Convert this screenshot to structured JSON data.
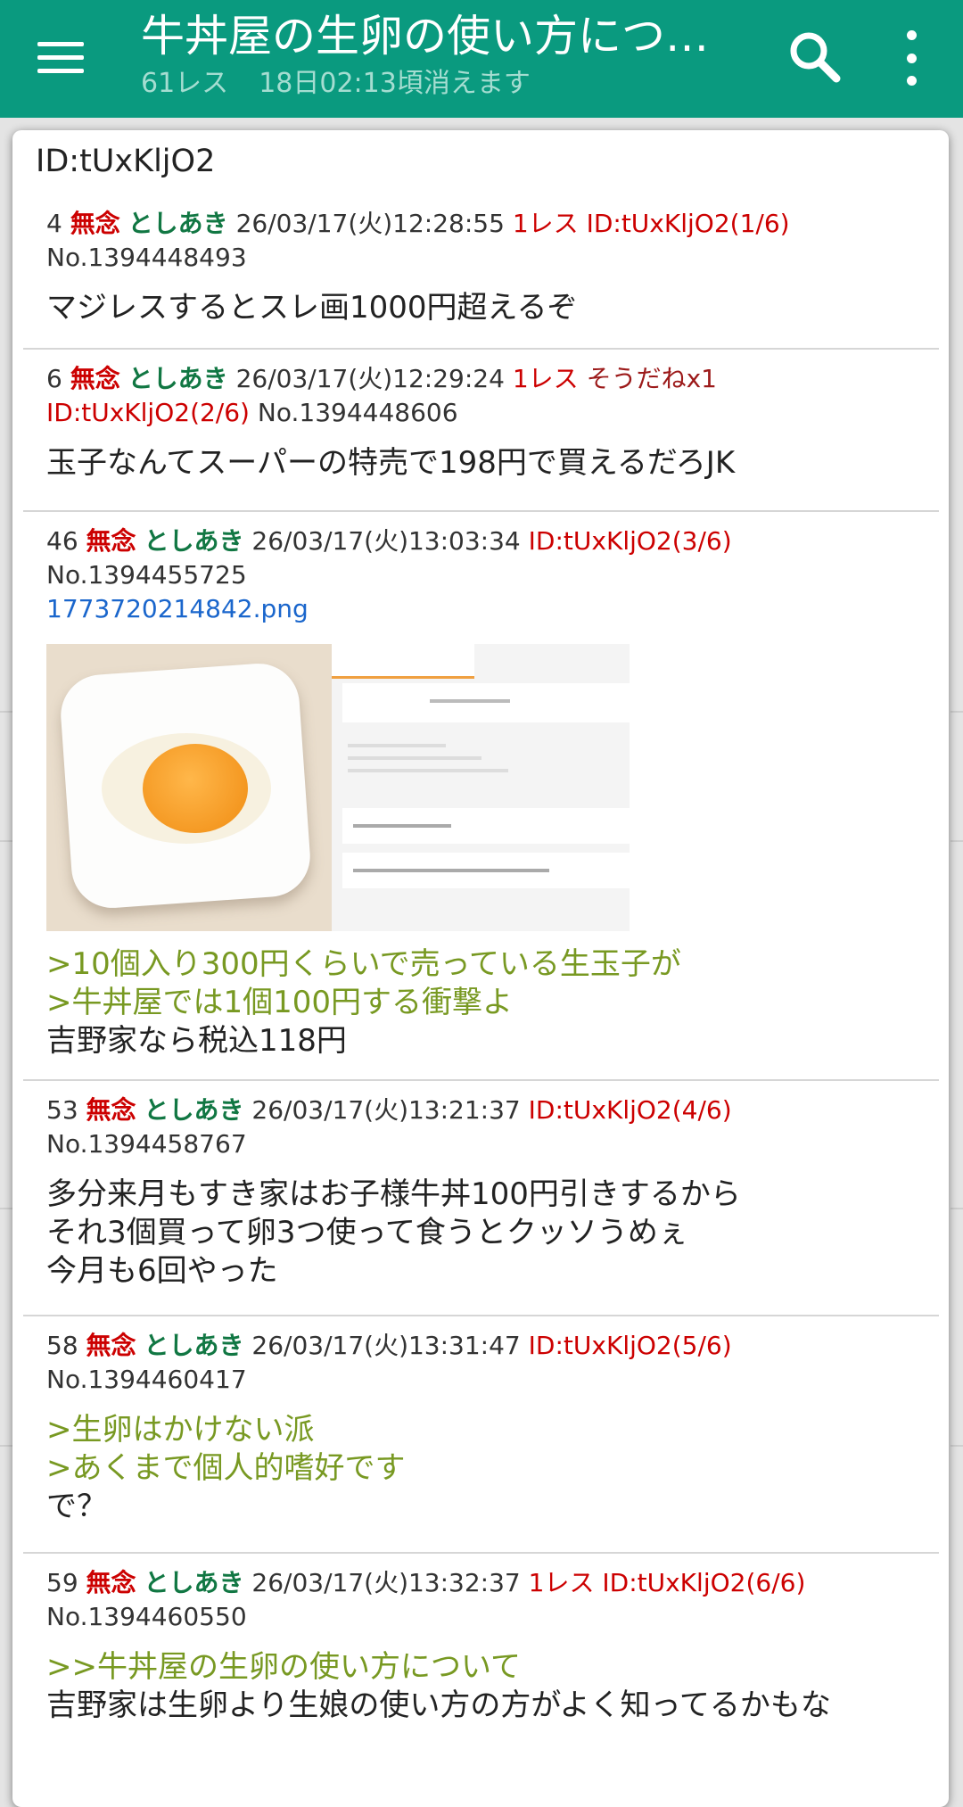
{
  "appbar": {
    "title": "牛丼屋の生卵の使い方につ…",
    "reply_count": "61レス",
    "expire": "18日02:13頃消えます",
    "menu_icon": "hamburger-menu-icon",
    "search_icon": "search-icon",
    "more_icon": "more-vert-icon"
  },
  "dialog": {
    "title": "ID:tUxKljO2",
    "posts": [
      {
        "num": "4",
        "mu": "無念",
        "name": "としあき",
        "date": "26/03/17(火)12:28:55",
        "res": "1レス",
        "id": "ID:tUxKljO2(1/6)",
        "no": "No.1394448493",
        "quotes": [],
        "lines": [
          "マジレスするとスレ画1000円超えるぞ"
        ]
      },
      {
        "num": "6",
        "mu": "無念",
        "name": "としあき",
        "date": "26/03/17(火)12:29:24",
        "res": "1レス",
        "sodane": "そうだねx1",
        "id": "ID:tUxKljO2(2/6)",
        "no": "No.1394448606",
        "quotes": [],
        "lines": [
          "玉子なんてスーパーの特売で198円で買えるだろJK"
        ]
      },
      {
        "num": "46",
        "mu": "無念",
        "name": "としあき",
        "date": "26/03/17(火)13:03:34",
        "id": "ID:tUxKljO2(3/6)",
        "no": "No.1394455725",
        "file": "1773720214842.png",
        "quotes": [
          ">10個入り300円くらいで売っている生玉子が",
          ">牛丼屋では1個100円する衝撃よ"
        ],
        "lines": [
          "吉野家なら税込118円"
        ]
      },
      {
        "num": "53",
        "mu": "無念",
        "name": "としあき",
        "date": "26/03/17(火)13:21:37",
        "id": "ID:tUxKljO2(4/6)",
        "no": "No.1394458767",
        "quotes": [],
        "lines": [
          "多分来月もすき家はお子様牛丼100円引きするから",
          "それ3個買って卵3つ使って食うとクッソうめぇ",
          "今月も6回やった"
        ]
      },
      {
        "num": "58",
        "mu": "無念",
        "name": "としあき",
        "date": "26/03/17(火)13:31:47",
        "id": "ID:tUxKljO2(5/6)",
        "no": "No.1394460417",
        "quotes": [
          ">生卵はかけない派",
          ">あくまで個人的嗜好です"
        ],
        "lines": [
          "で？"
        ]
      },
      {
        "num": "59",
        "mu": "無念",
        "name": "としあき",
        "date": "26/03/17(火)13:32:37",
        "res": "1レス",
        "id": "ID:tUxKljO2(6/6)",
        "no": "No.1394460550",
        "quotes": [
          ">>牛丼屋の生卵の使い方について"
        ],
        "lines": [
          "吉野家は生卵より生娘の使い方の方がよく知ってるかもな"
        ]
      }
    ]
  },
  "colors": {
    "appbar": "#0a9a7f",
    "mu_red": "#cc0000",
    "name_green": "#117743",
    "quote_green": "#789922",
    "link_blue": "#1a66cc"
  }
}
